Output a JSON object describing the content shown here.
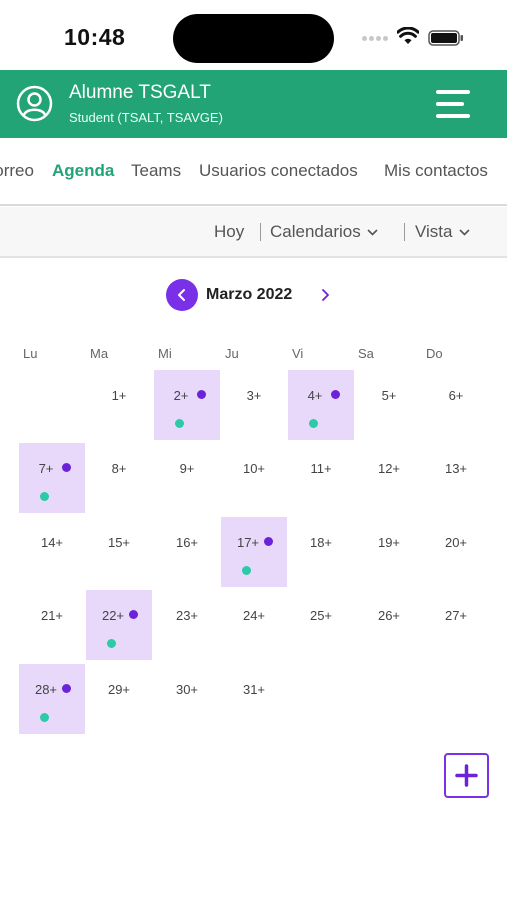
{
  "status_bar": {
    "time": "10:48"
  },
  "header": {
    "user_name": "Alumne TSGALT",
    "user_role": "Student (TSALT, TSAVGE)",
    "accent_color": "#23a476"
  },
  "nav": {
    "tabs": [
      {
        "label": "Correo"
      },
      {
        "label": "Agenda",
        "active": true
      },
      {
        "label": "Teams"
      },
      {
        "label": "Usuarios conectados"
      },
      {
        "label": "Mis contactos"
      }
    ]
  },
  "toolbar": {
    "today_label": "Hoy",
    "calendars_label": "Calendarios",
    "view_label": "Vista"
  },
  "calendar": {
    "month_label": "Marzo 2022",
    "weekdays": [
      "Lu",
      "Ma",
      "Mi",
      "Ju",
      "Vi",
      "Sa",
      "Do"
    ],
    "days": [
      {
        "label": "1+"
      },
      {
        "label": "2+",
        "event": true
      },
      {
        "label": "3+"
      },
      {
        "label": "4+",
        "event": true
      },
      {
        "label": "5+"
      },
      {
        "label": "6+"
      },
      {
        "label": "7+",
        "event": true
      },
      {
        "label": "8+"
      },
      {
        "label": "9+"
      },
      {
        "label": "10+"
      },
      {
        "label": "11+"
      },
      {
        "label": "12+"
      },
      {
        "label": "13+"
      },
      {
        "label": "14+"
      },
      {
        "label": "15+"
      },
      {
        "label": "16+"
      },
      {
        "label": "17+",
        "event": true
      },
      {
        "label": "18+"
      },
      {
        "label": "19+"
      },
      {
        "label": "20+"
      },
      {
        "label": "21+"
      },
      {
        "label": "22+",
        "event": true
      },
      {
        "label": "23+"
      },
      {
        "label": "24+"
      },
      {
        "label": "25+"
      },
      {
        "label": "26+"
      },
      {
        "label": "27+"
      },
      {
        "label": "28+",
        "event": true
      },
      {
        "label": "29+"
      },
      {
        "label": "30+"
      },
      {
        "label": "31+"
      }
    ],
    "event_highlight_color": "#e8d9fa",
    "event_dot_colors": [
      "#6b22d8",
      "#2ccaa6"
    ]
  },
  "icons": {
    "avatar": "user-circle-icon",
    "menu": "hamburger-menu-icon",
    "prev": "chevron-left-icon",
    "next": "chevron-right-icon",
    "add": "plus-icon"
  }
}
